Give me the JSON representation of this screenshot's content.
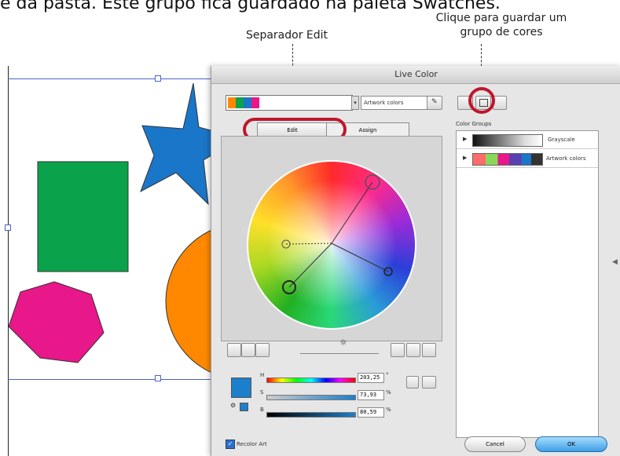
{
  "caption": "e da pasta. Este grupo fica guardado na paleta Swatches.",
  "annotations": {
    "edit_tab": "Separador Edit",
    "save_group": "Clique para guardar um grupo de cores"
  },
  "dialog": {
    "title": "Live Color",
    "color_group_name": "Artwork colors",
    "tabs": {
      "edit": "Edit",
      "assign": "Assign"
    },
    "color_groups_label": "Color Groups",
    "color_groups": [
      {
        "name": "Grayscale"
      },
      {
        "name": "Artwork colors"
      }
    ],
    "hsb": {
      "h_label": "H",
      "h_value": "203,25",
      "s_label": "S",
      "s_value": "73,93",
      "b_label": "B",
      "b_value": "80,59",
      "degree": "°",
      "percent": "%"
    },
    "recolor_label": "Recolor Art",
    "cancel_label": "Cancel",
    "ok_label": "OK"
  },
  "colors": {
    "annotation_ring": "#c0162a",
    "ok_button": "#58b4f0",
    "current_color": "#1b7fcc",
    "artwork_swatches": [
      "#ff8800",
      "#0aa24a",
      "#1a76c8",
      "#e8178a"
    ]
  }
}
